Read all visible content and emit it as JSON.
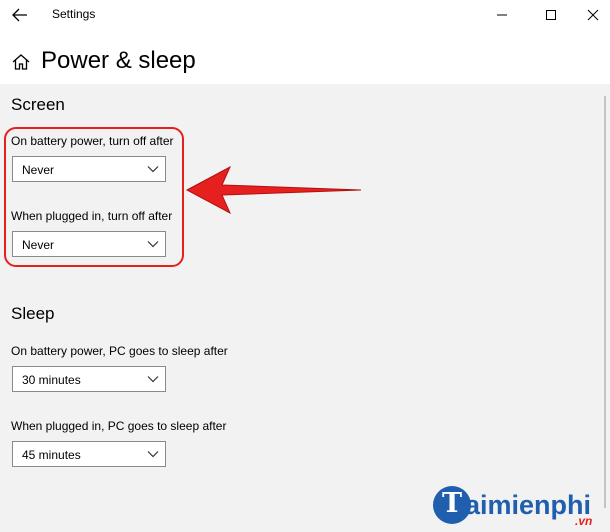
{
  "window": {
    "title": "Settings",
    "controls": [
      "minimize",
      "maximize",
      "close"
    ]
  },
  "page": {
    "title": "Power & sleep"
  },
  "screen": {
    "title": "Screen",
    "battery_label": "On battery power, turn off after",
    "battery_value": "Never",
    "plugged_label": "When plugged in, turn off after",
    "plugged_value": "Never"
  },
  "sleep": {
    "title": "Sleep",
    "battery_label": "On battery power, PC goes to sleep after",
    "battery_value": "30 minutes",
    "plugged_label": "When plugged in, PC goes to sleep after",
    "plugged_value": "45 minutes"
  },
  "annotation": {
    "color": "#e5201f"
  },
  "watermark": {
    "initial": "T",
    "name": "aimienphi",
    "suffix": ".vn"
  },
  "icons": {
    "back": "back-arrow-icon",
    "home": "home-icon",
    "dropdown": "chevron-down-icon"
  }
}
